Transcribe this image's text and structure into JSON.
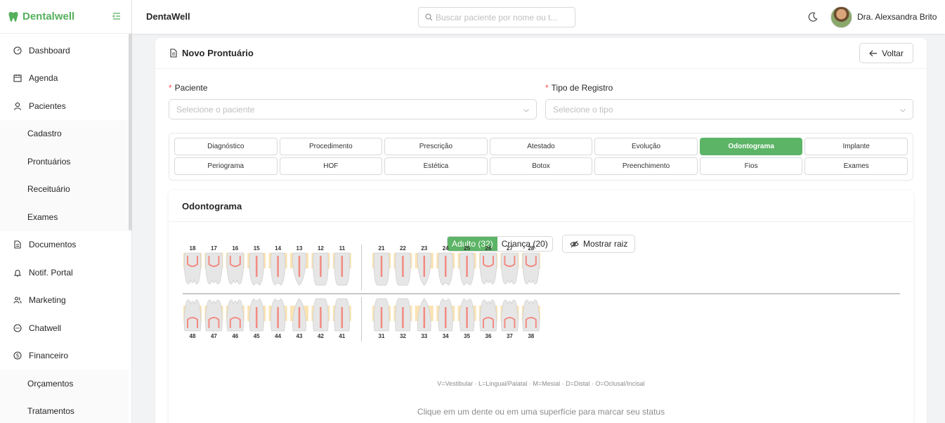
{
  "brand": {
    "name": "Dentalwell"
  },
  "header": {
    "title": "DentaWell",
    "search_placeholder": "Buscar paciente por nome ou t...",
    "user_name": "Dra. Alexsandra Brito"
  },
  "sidebar": {
    "items": [
      {
        "label": "Dashboard",
        "icon": "dashboard-icon"
      },
      {
        "label": "Agenda",
        "icon": "calendar-icon"
      },
      {
        "label": "Pacientes",
        "icon": "user-icon"
      }
    ],
    "pacientes_sub": [
      "Cadastro",
      "Prontuários",
      "Receituário",
      "Exames"
    ],
    "items2": [
      {
        "label": "Documentos",
        "icon": "document-icon"
      },
      {
        "label": "Notif. Portal",
        "icon": "bell-icon"
      },
      {
        "label": "Marketing",
        "icon": "users-icon"
      },
      {
        "label": "Chatwell",
        "icon": "chat-icon"
      },
      {
        "label": "Financeiro",
        "icon": "dollar-icon"
      }
    ],
    "financeiro_sub": [
      "Orçamentos",
      "Tratamentos"
    ]
  },
  "page": {
    "title": "Novo Prontuário",
    "back_label": "Voltar",
    "paciente_label": "Paciente",
    "paciente_placeholder": "Selecione o paciente",
    "tipo_label": "Tipo de Registro",
    "tipo_placeholder": "Selecione o tipo"
  },
  "record_types": [
    {
      "label": "Diagnóstico",
      "active": false
    },
    {
      "label": "Procedimento",
      "active": false
    },
    {
      "label": "Prescrição",
      "active": false
    },
    {
      "label": "Atestado",
      "active": false
    },
    {
      "label": "Evolução",
      "active": false
    },
    {
      "label": "Odontograma",
      "active": true
    },
    {
      "label": "Implante",
      "active": false
    },
    {
      "label": "Periograma",
      "active": false
    },
    {
      "label": "HOF",
      "active": false
    },
    {
      "label": "Estética",
      "active": false
    },
    {
      "label": "Botox",
      "active": false
    },
    {
      "label": "Preenchimento",
      "active": false
    },
    {
      "label": "Fios",
      "active": false
    },
    {
      "label": "Exames",
      "active": false
    }
  ],
  "odontogram": {
    "title": "Odontograma",
    "adult_label": "Adulto (32)",
    "child_label": "Criança (20)",
    "root_label": "Mostrar raiz",
    "upper_right": [
      "18",
      "17",
      "16",
      "15",
      "14",
      "13",
      "12",
      "11"
    ],
    "upper_left": [
      "21",
      "22",
      "23",
      "24",
      "25",
      "26",
      "27",
      "28"
    ],
    "lower_right": [
      "48",
      "47",
      "46",
      "45",
      "44",
      "43",
      "42",
      "41"
    ],
    "lower_left": [
      "31",
      "32",
      "33",
      "34",
      "35",
      "36",
      "37",
      "38"
    ],
    "legend": "V=Vestibular · L=Lingual/Palatal · M=Mesial · D=Distal · O=Oclusal/Incisal",
    "hint": "Clique em um dente ou em uma superfície para marcar seu status"
  },
  "colors": {
    "accent": "#5cb466",
    "brand": "#55b05c",
    "gum": "#fae3b4",
    "pulp": "#f28b82",
    "tooth": "#e6e6e6"
  }
}
